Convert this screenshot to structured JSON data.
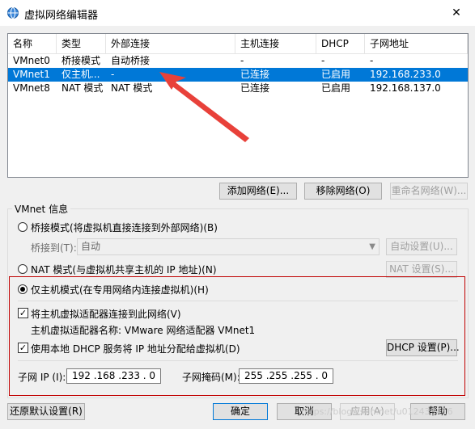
{
  "window": {
    "title": "虚拟网络编辑器",
    "close": "✕"
  },
  "table": {
    "columns": [
      "名称",
      "类型",
      "外部连接",
      "主机连接",
      "DHCP",
      "子网地址"
    ],
    "rows": [
      [
        "VMnet0",
        "桥接模式",
        "自动桥接",
        "-",
        "-",
        "-"
      ],
      [
        "VMnet1",
        "仅主机...",
        "-",
        "已连接",
        "已启用",
        "192.168.233.0"
      ],
      [
        "VMnet8",
        "NAT 模式",
        "NAT 模式",
        "已连接",
        "已启用",
        "192.168.137.0"
      ]
    ],
    "selected_row": 1
  },
  "buttons": {
    "add_network": "添加网络(E)...",
    "remove_network": "移除网络(O)",
    "rename_network": "重命名网络(W)..."
  },
  "vmnet_info": {
    "label": "VMnet 信息",
    "bridge_mode": "桥接模式(将虚拟机直接连接到外部网络)(B)",
    "bridge_to_label": "桥接到(T):",
    "bridge_to_value": "自动",
    "auto_settings": "自动设置(U)...",
    "nat_mode": "NAT 模式(与虚拟机共享主机的 IP 地址)(N)",
    "nat_settings": "NAT 设置(S)...",
    "host_only_mode": "仅主机模式(在专用网络内连接虚拟机)(H)",
    "connect_adapter": "将主机虚拟适配器连接到此网络(V)",
    "adapter_name": "主机虚拟适配器名称: VMware 网络适配器 VMnet1",
    "use_dhcp": "使用本地 DHCP 服务将 IP 地址分配给虚拟机(D)",
    "dhcp_settings": "DHCP 设置(P)...",
    "subnet_ip_label": "子网 IP (I):",
    "subnet_ip": "192 .168 .233 . 0",
    "subnet_mask_label": "子网掩码(M):",
    "subnet_mask": "255 .255 .255 . 0"
  },
  "footer": {
    "restore_defaults": "还原默认设置(R)",
    "ok": "确定",
    "cancel": "取消",
    "apply": "应用(A)",
    "help": "帮助"
  },
  "watermark": "https://blog.csdn.net/u012439416",
  "colors": {
    "selection": "#0078d7",
    "highlight_box": "#c00000",
    "annotation_arrow": "#e8413a"
  }
}
